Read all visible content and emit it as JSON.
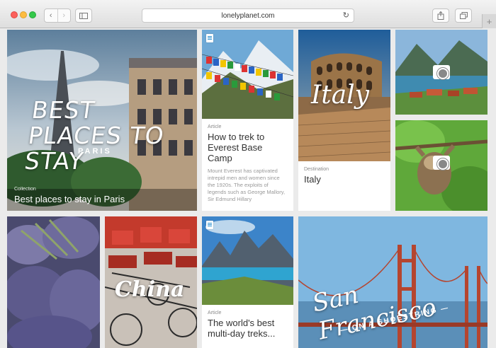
{
  "browser": {
    "url": "lonelyplanet.com",
    "back_icon": "chevron-left-icon",
    "forward_icon": "chevron-right-icon",
    "sidebar_icon": "sidebar-icon",
    "reload_icon": "reload-icon",
    "share_icon": "share-icon",
    "tabs_icon": "tabs-icon",
    "new_tab_label": "+"
  },
  "tiles": {
    "hero": {
      "image_title": "BEST PLACES TO STAY",
      "image_subtitle": "PARIS",
      "kicker": "Collection",
      "headline": "Best places to stay in Paris"
    },
    "everest": {
      "kicker": "Article",
      "headline": "How to trek to Everest Base Camp",
      "excerpt": "Mount Everest has captivated intrepid men and women since the 1920s. The exploits of legends such as George Mallory, Sir Edmund Hillary"
    },
    "italy": {
      "image_title": "Italy",
      "kicker": "Destination",
      "headline": "Italy"
    },
    "china": {
      "image_title": "China"
    },
    "treks": {
      "kicker": "Article",
      "headline": "The world's best multi-day treks..."
    },
    "sanfrancisco": {
      "image_title": "San Francisco",
      "image_subtitle": "— ON A SHOESTRING —"
    }
  },
  "colors": {
    "accent": "#2a8fd0",
    "traffic_close": "#fc605c",
    "traffic_min": "#fdbc40",
    "traffic_max": "#34c84a"
  }
}
